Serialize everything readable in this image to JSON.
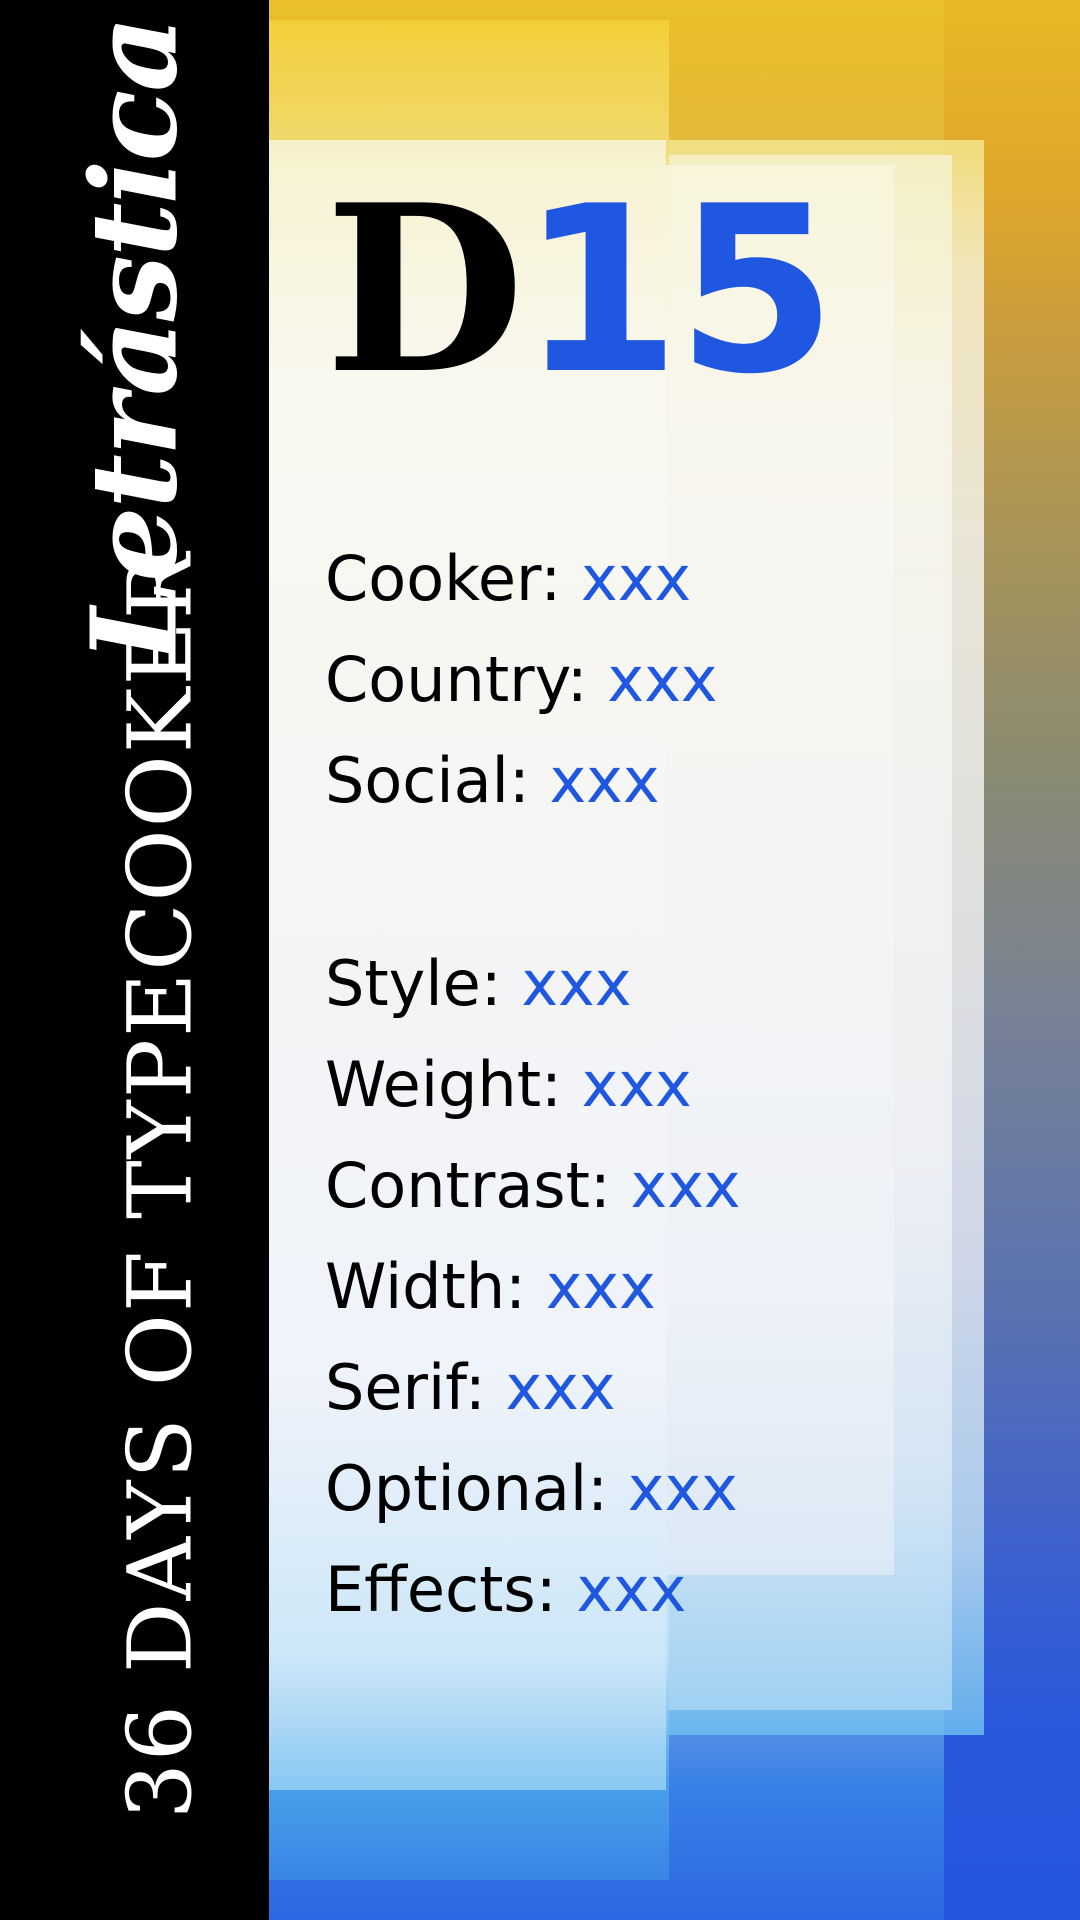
{
  "sidebar": {
    "brand": "Letrástica",
    "series": "36 DAYS OF TYPECOOKER"
  },
  "title": {
    "letter": "D",
    "number": "15"
  },
  "fields": [
    {
      "label": "Cooker:",
      "value": "xxx"
    },
    {
      "label": "Country:",
      "value": "xxx"
    },
    {
      "label": "Social:",
      "value": "xxx"
    },
    {
      "label": "Style:",
      "value": "xxx"
    },
    {
      "label": "Weight:",
      "value": "xxx"
    },
    {
      "label": "Contrast:",
      "value": "xxx"
    },
    {
      "label": "Width:",
      "value": "xxx"
    },
    {
      "label": "Serif:",
      "value": "xxx"
    },
    {
      "label": "Optional:",
      "value": "xxx"
    },
    {
      "label": "Effects:",
      "value": "xxx"
    }
  ],
  "colors": {
    "accent": "#1f57e0",
    "sidebar": "#000000",
    "gradient_top": "#e9b826",
    "gradient_bottom": "#2456e0"
  }
}
